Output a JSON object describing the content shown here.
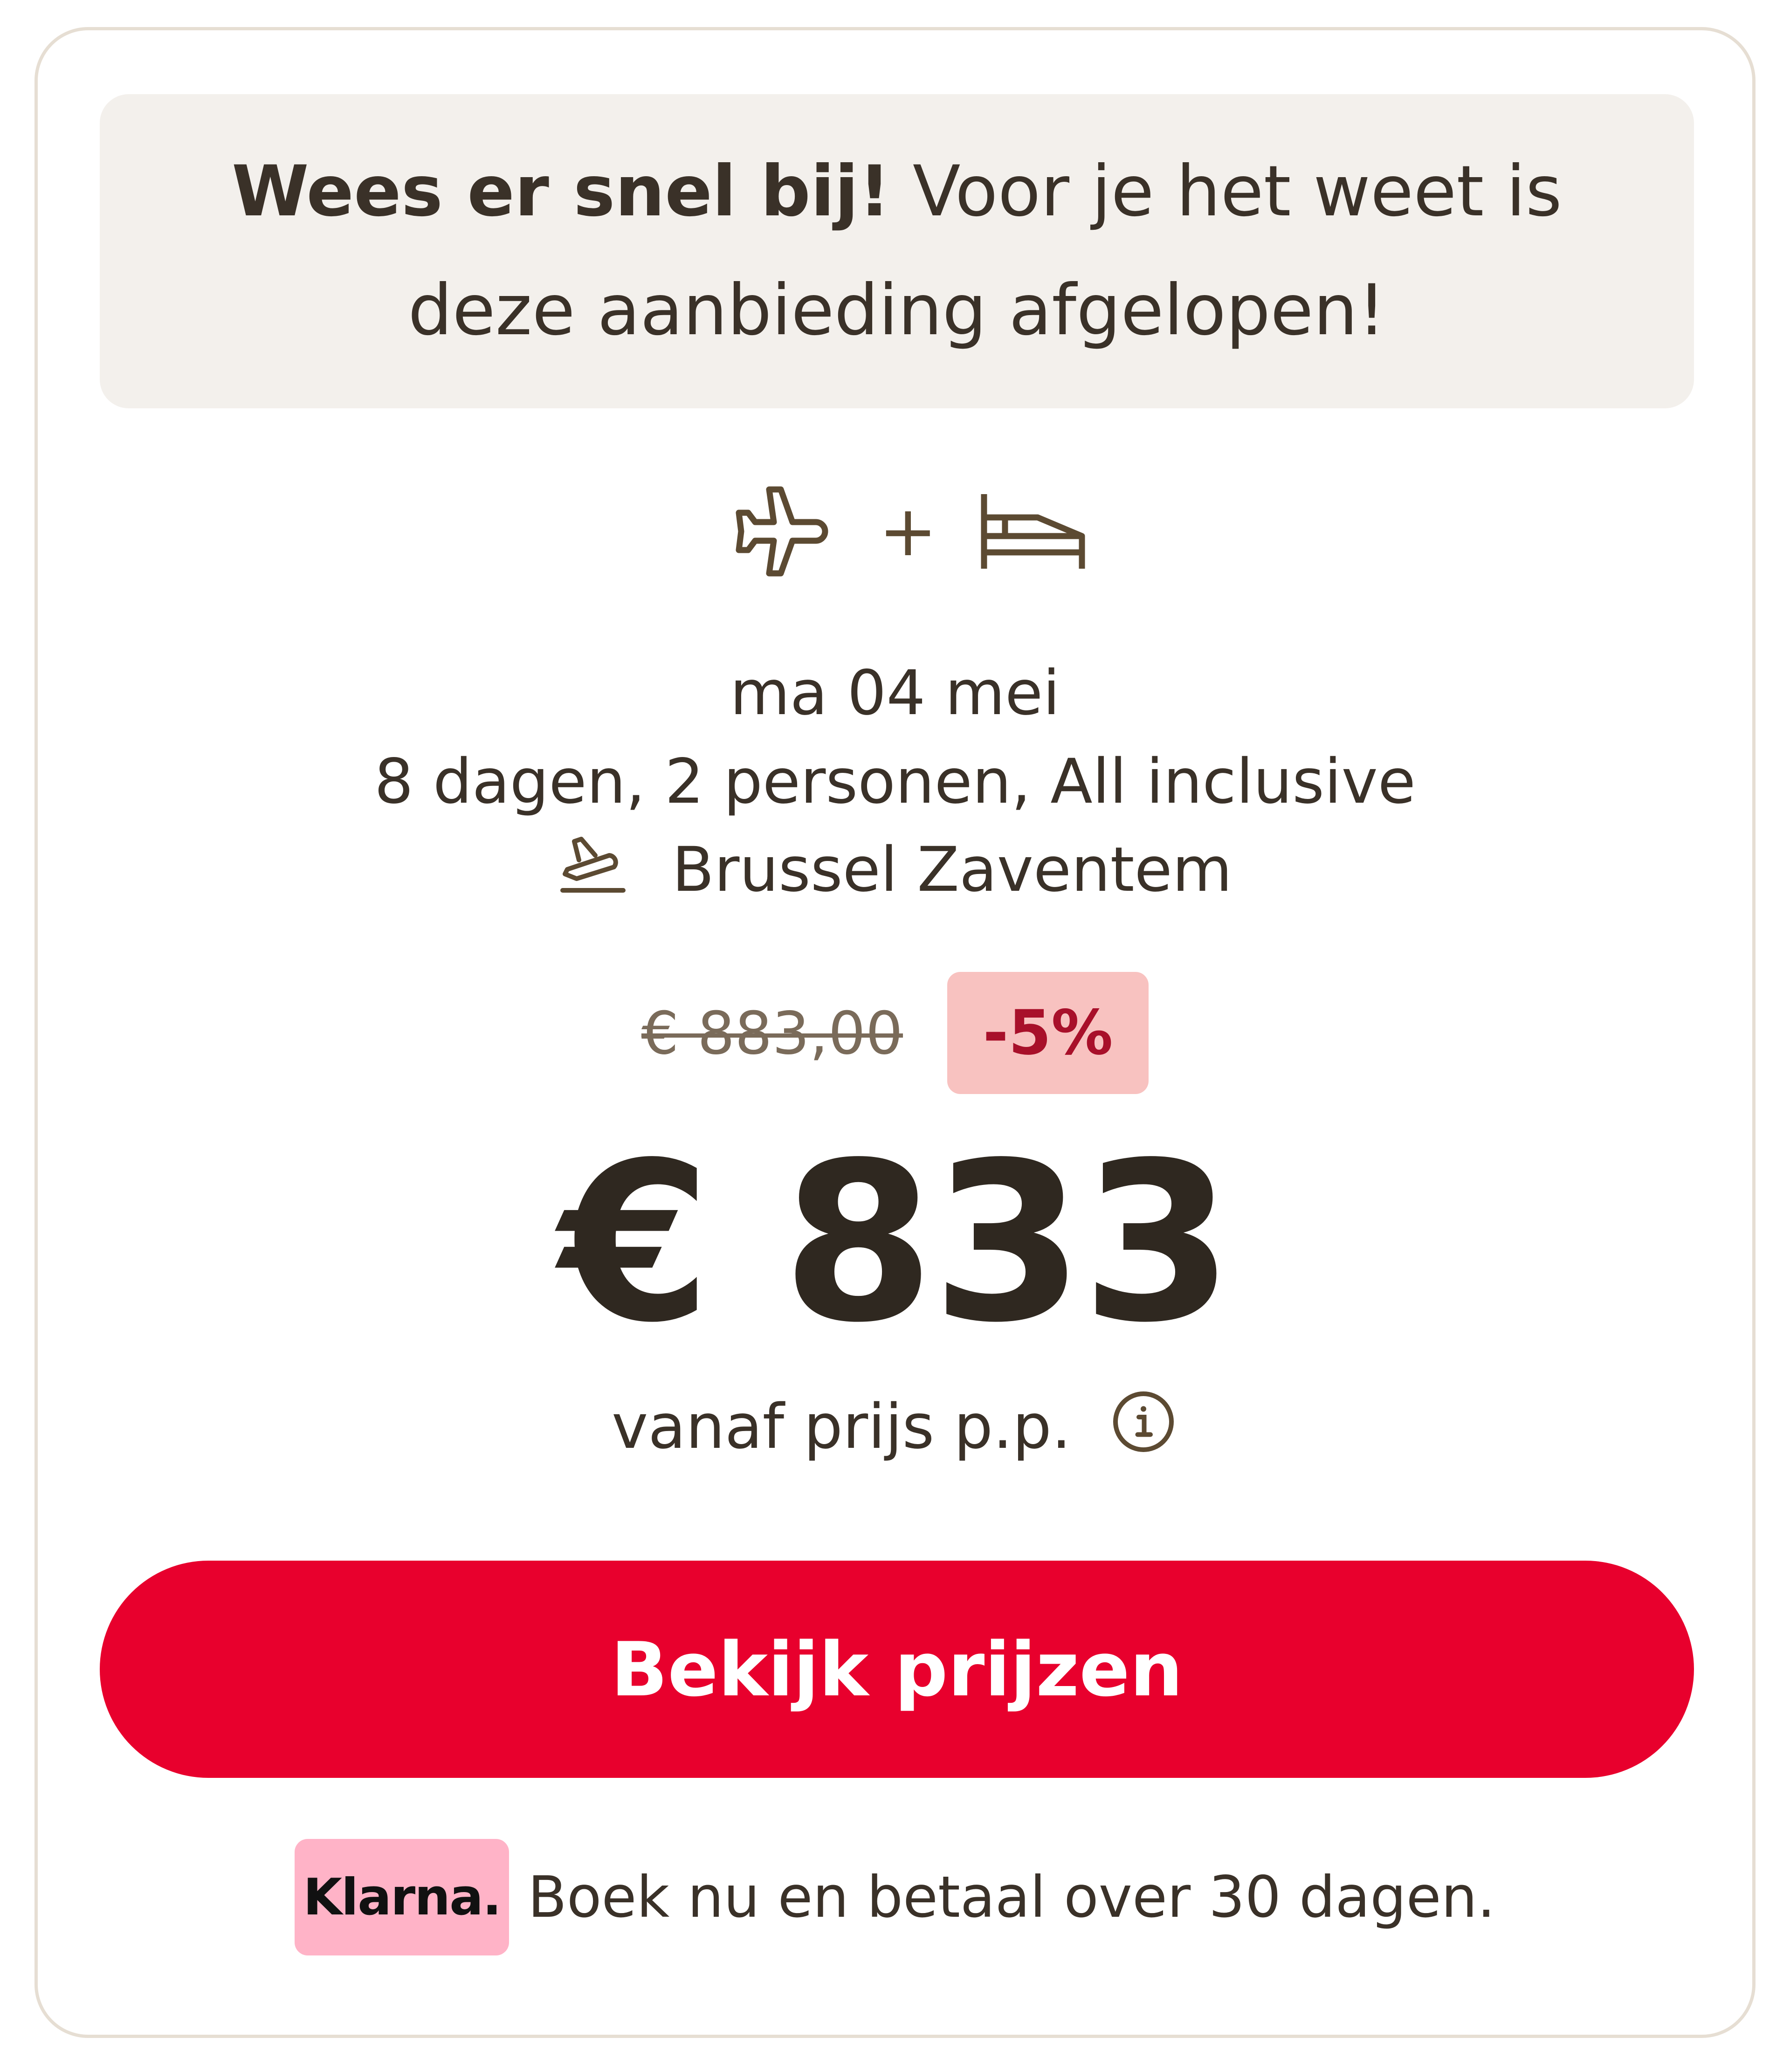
{
  "banner": {
    "bold_text": "Wees er snel bij!",
    "text_line1_rest": " Voor je het weet is",
    "text_line2": "deze aanbieding afgelopen!"
  },
  "icons": {
    "flight": "plane-icon",
    "plus": "+",
    "hotel": "bed-icon",
    "departure": "plane-takeoff-icon",
    "info": "info-icon"
  },
  "trip": {
    "date": "ma 04 mei",
    "summary": "8 dagen, 2 personen, All inclusive",
    "airport": "Brussel Zaventem"
  },
  "pricing": {
    "old_price": "€ 883,00",
    "discount": "-5%",
    "price": "€ 833",
    "price_label": "vanaf prijs p.p."
  },
  "cta": {
    "label": "Bekijk prijzen"
  },
  "klarna": {
    "logo_text": "Klarna.",
    "message": "Boek nu en betaal over 30 dagen."
  },
  "colors": {
    "accent": "#e8002d",
    "discount_bg": "#f8c2c0",
    "discount_text": "#a8102a",
    "banner_bg": "#f3f0ec",
    "klarna_bg": "#ffb3c7"
  }
}
